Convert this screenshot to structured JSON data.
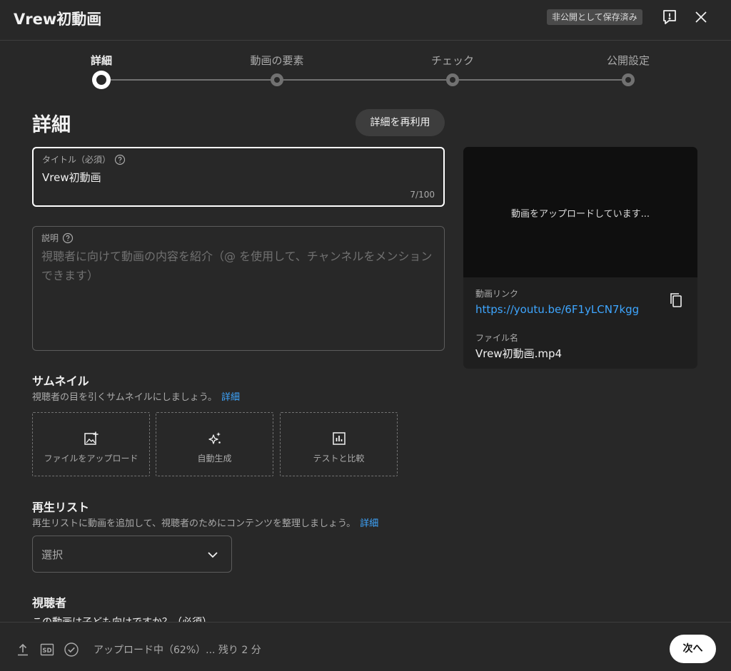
{
  "header": {
    "title": "Vrew初動画",
    "saved_badge": "非公開として保存済み",
    "feedback_icon": "feedback-icon",
    "close_icon": "close-icon"
  },
  "stepper": {
    "steps": [
      {
        "label": "詳細",
        "active": true
      },
      {
        "label": "動画の要素",
        "active": false
      },
      {
        "label": "チェック",
        "active": false
      },
      {
        "label": "公開設定",
        "active": false
      }
    ]
  },
  "details": {
    "heading": "詳細",
    "reuse_button": "詳細を再利用",
    "title_field": {
      "label": "タイトル（必須）",
      "value": "Vrew初動画",
      "counter": "7/100"
    },
    "description_field": {
      "label": "説明",
      "placeholder": "視聴者に向けて動画の内容を紹介（@ を使用して、チャンネルをメンションできます）"
    }
  },
  "preview": {
    "status": "動画をアップロードしています...",
    "link_label": "動画リンク",
    "link_value": "https://youtu.be/6F1yLCN7kgg",
    "file_label": "ファイル名",
    "file_value": "Vrew初動画.mp4"
  },
  "thumbnail": {
    "heading": "サムネイル",
    "description": "視聴者の目を引くサムネイルにしましょう。",
    "more_link": "詳細",
    "options": [
      {
        "label": "ファイルをアップロード",
        "icon": "add-photo-icon"
      },
      {
        "label": "自動生成",
        "icon": "sparkle-icon"
      },
      {
        "label": "テストと比較",
        "icon": "bar-chart-icon"
      }
    ]
  },
  "playlist": {
    "heading": "再生リスト",
    "description": "再生リストに動画を追加して、視聴者のためにコンテンツを整理しましょう。",
    "more_link": "詳細",
    "select_value": "選択"
  },
  "audience": {
    "heading": "視聴者",
    "question": "この動画は子ども向けですか？（必須）"
  },
  "footer": {
    "status": "アップロード中（62%）... 残り 2 分",
    "progress_percent": 62,
    "next_button": "次へ"
  },
  "colors": {
    "background": "#282828",
    "link": "#3ea6ff",
    "muted_text": "#aaaaaa"
  }
}
